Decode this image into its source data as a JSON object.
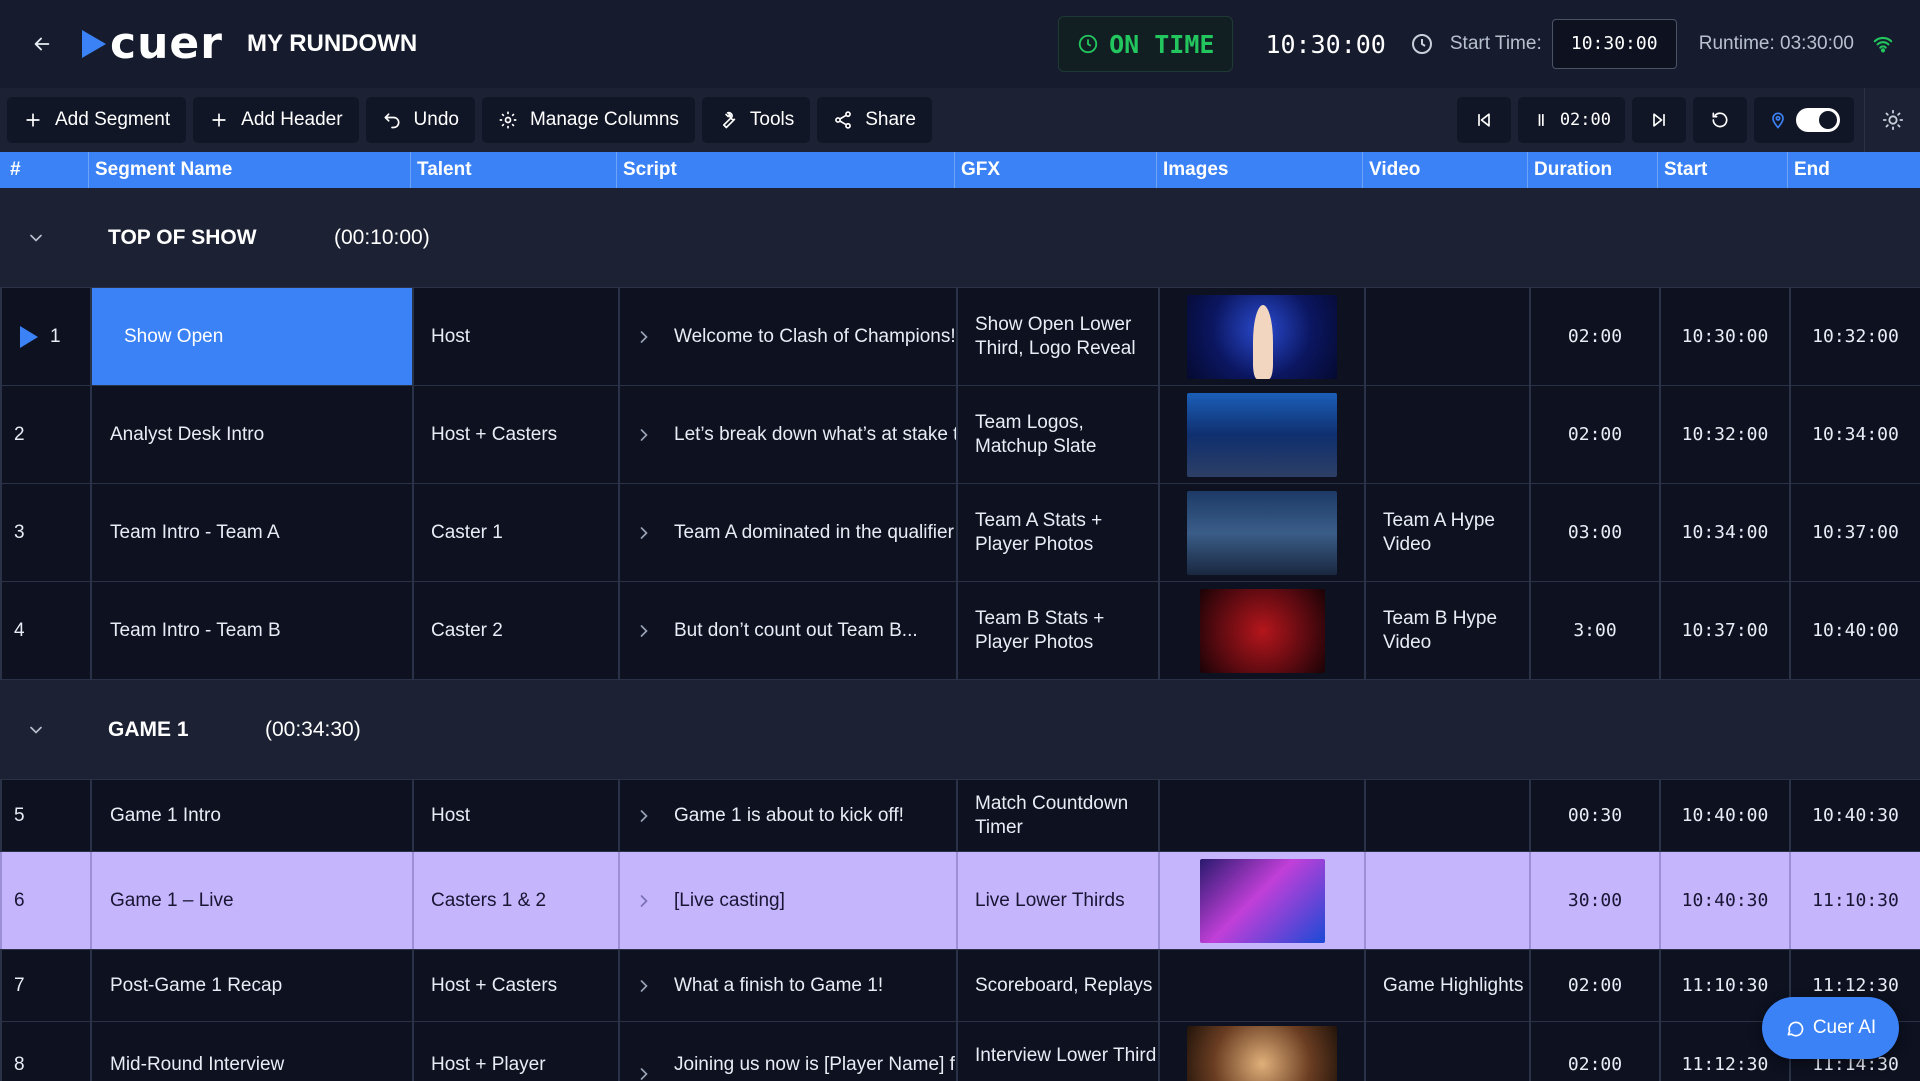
{
  "app": {
    "brand": "cuer",
    "title": "MY RUNDOWN"
  },
  "status": {
    "on_time": "ON TIME",
    "current_time": "10:30:00",
    "start_time_label": "Start Time:",
    "start_time_value": "10:30:00",
    "runtime": "Runtime: 03:30:00"
  },
  "toolbar": {
    "add_segment": "Add Segment",
    "add_header": "Add Header",
    "undo": "Undo",
    "manage_columns": "Manage Columns",
    "tools": "Tools",
    "share": "Share",
    "timer": "02:00"
  },
  "columns": [
    "#",
    "Segment Name",
    "Talent",
    "Script",
    "GFX",
    "Images",
    "Video",
    "Duration",
    "Start",
    "End"
  ],
  "headers": [
    {
      "name": "TOP OF SHOW",
      "duration": "(00:10:00)"
    },
    {
      "name": "GAME 1",
      "duration": "(00:34:30)"
    }
  ],
  "rows": [
    {
      "num": "1",
      "segment": "Show Open",
      "talent": "Host",
      "script": "Welcome to Clash of Champions!",
      "gfx": "Show Open Lower Third, Logo Reveal",
      "video": "",
      "duration": "02:00",
      "start": "10:30:00",
      "end": "10:32:00"
    },
    {
      "num": "2",
      "segment": "Analyst Desk Intro",
      "talent": "Host + Casters",
      "script": "Let’s break down what’s at stake t",
      "gfx": "Team Logos, Matchup Slate",
      "video": "",
      "duration": "02:00",
      "start": "10:32:00",
      "end": "10:34:00"
    },
    {
      "num": "3",
      "segment": "Team Intro - Team A",
      "talent": "Caster 1",
      "script": "Team A dominated in the qualifier",
      "gfx": "Team A Stats + Player Photos",
      "video": "Team A Hype Video",
      "duration": "03:00",
      "start": "10:34:00",
      "end": "10:37:00"
    },
    {
      "num": "4",
      "segment": "Team Intro - Team B",
      "talent": "Caster 2",
      "script": "But don’t count out Team B...",
      "gfx": "Team B Stats + Player Photos",
      "video": "Team B Hype Video",
      "duration": "3:00",
      "start": "10:37:00",
      "end": "10:40:00"
    },
    {
      "num": "5",
      "segment": "Game 1 Intro",
      "talent": "Host",
      "script": "Game 1 is about to kick off!",
      "gfx": "Match Countdown Timer",
      "video": "",
      "duration": "00:30",
      "start": "10:40:00",
      "end": "10:40:30"
    },
    {
      "num": "6",
      "segment": "Game 1 – Live",
      "talent": "Casters 1 & 2",
      "script": "[Live casting]",
      "gfx": "Live Lower Thirds",
      "video": "",
      "duration": "30:00",
      "start": "10:40:30",
      "end": "11:10:30"
    },
    {
      "num": "7",
      "segment": "Post-Game 1 Recap",
      "talent": "Host + Casters",
      "script": "What a finish to Game 1!",
      "gfx": "Scoreboard, Replays",
      "video": "Game Highlights",
      "duration": "02:00",
      "start": "11:10:30",
      "end": "11:12:30"
    },
    {
      "num": "8",
      "segment": "Mid-Round Interview",
      "talent": "Host + Player",
      "script": "Joining us now is [Player Name] fr",
      "gfx": "Interview Lower Third",
      "video": "",
      "duration": "02:00",
      "start": "11:12:30",
      "end": "11:14:30"
    }
  ],
  "assistant": {
    "label": "Cuer AI"
  },
  "colors": {
    "accent": "#3b82f6",
    "on_time": "#22c55e",
    "live_row": "#c4b5fd",
    "header_row": "#1c2233"
  }
}
